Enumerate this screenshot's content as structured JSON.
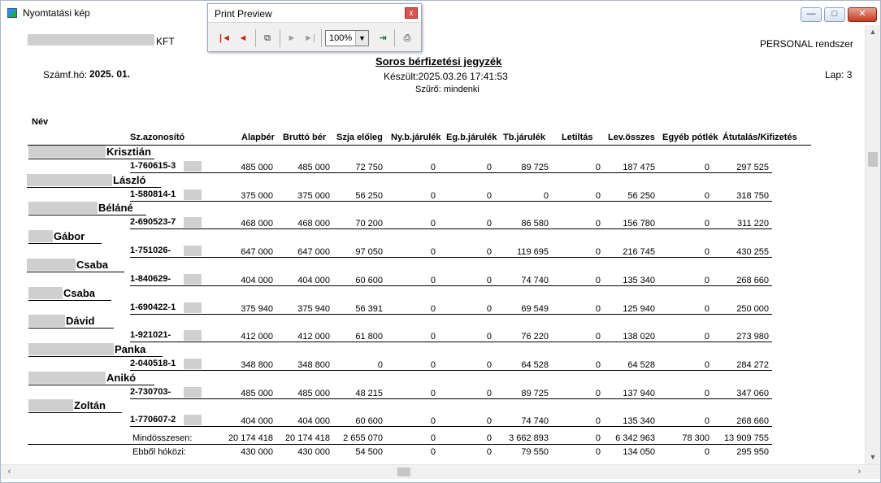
{
  "window": {
    "title": "Nyomtatási kép",
    "min_glyph": "—",
    "max_glyph": "□",
    "close_glyph": "✕"
  },
  "print_preview": {
    "title": "Print Preview",
    "zoom": "100%",
    "close_glyph": "x",
    "first_glyph": "|◄",
    "prev_glyph": "◄",
    "pages_glyph": "⧉",
    "next_glyph": "►",
    "last_glyph": "►|",
    "dd_glyph": "▼",
    "exit_glyph": "⇥",
    "print_glyph": "⎙"
  },
  "report": {
    "company_suffix": "KFT",
    "system": "PERSONAL rendszer",
    "period_label": "Számf.hó:",
    "period_value": "2025. 01.",
    "title": "Soros bérfizetési jegyzék",
    "created": "Készült:2025.03.26 17:41:53",
    "filter": "Szűrő: mindenki",
    "page": "Lap:  3",
    "columns": {
      "name": "Név",
      "id": "Sz.azonosító",
      "base": "Alapbér",
      "gross": "Bruttó bér",
      "tax": "Szja előleg",
      "ny": "Ny.b.járulék",
      "eg": "Eg.b.járulék",
      "tb": "Tb.járulék",
      "garn": "Letiltás",
      "ded": "Lev.összes",
      "other": "Egyéb pótlék",
      "pay": "Átutalás/Kifizetés"
    },
    "rows": [
      {
        "name": "Krisztián",
        "id": "1-760615-3",
        "v": [
          "485 000",
          "485 000",
          "72 750",
          "0",
          "0",
          "89 725",
          "0",
          "187 475",
          "0",
          "297 525"
        ]
      },
      {
        "name": "László",
        "id": "1-580814-1",
        "v": [
          "375 000",
          "375 000",
          "56 250",
          "0",
          "0",
          "0",
          "0",
          "56 250",
          "0",
          "318 750"
        ]
      },
      {
        "name": "Béláné",
        "id": "2-690523-7",
        "v": [
          "468 000",
          "468 000",
          "70 200",
          "0",
          "0",
          "86 580",
          "0",
          "156 780",
          "0",
          "311 220"
        ]
      },
      {
        "name": "Gábor",
        "id": "1-751026-",
        "v": [
          "647 000",
          "647 000",
          "97 050",
          "0",
          "0",
          "119 695",
          "0",
          "216 745",
          "0",
          "430 255"
        ]
      },
      {
        "name": "Csaba",
        "id": "1-840629-",
        "v": [
          "404 000",
          "404 000",
          "60 600",
          "0",
          "0",
          "74 740",
          "0",
          "135 340",
          "0",
          "268 660"
        ]
      },
      {
        "name": "Csaba",
        "id": "1-690422-1",
        "v": [
          "375 940",
          "375 940",
          "56 391",
          "0",
          "0",
          "69 549",
          "0",
          "125 940",
          "0",
          "250 000"
        ]
      },
      {
        "name": "Dávid",
        "id": "1-921021-",
        "v": [
          "412 000",
          "412 000",
          "61 800",
          "0",
          "0",
          "76 220",
          "0",
          "138 020",
          "0",
          "273 980"
        ]
      },
      {
        "name": "Panka",
        "id": "2-040518-1",
        "v": [
          "348 800",
          "348 800",
          "0",
          "0",
          "0",
          "64 528",
          "0",
          "64 528",
          "0",
          "284 272"
        ]
      },
      {
        "name": "Anikó",
        "id": "2-730703-",
        "v": [
          "485 000",
          "485 000",
          "48 215",
          "0",
          "0",
          "89 725",
          "0",
          "137 940",
          "0",
          "347 060"
        ]
      },
      {
        "name": "Zoltán",
        "id": "1-770607-2",
        "v": [
          "404 000",
          "404 000",
          "60 600",
          "0",
          "0",
          "74 740",
          "0",
          "135 340",
          "0",
          "268 660"
        ]
      }
    ],
    "total": {
      "label": "Mindösszesen:",
      "v": [
        "20 174 418",
        "20 174 418",
        "2 655 070",
        "0",
        "0",
        "3 662 893",
        "0",
        "6 342 963",
        "78 300",
        "13 909 755"
      ]
    },
    "subtotal": {
      "label": "Ebből hóközi:",
      "v": [
        "430 000",
        "430 000",
        "54 500",
        "0",
        "0",
        "79 550",
        "0",
        "134 050",
        "0",
        "295 950"
      ]
    }
  }
}
